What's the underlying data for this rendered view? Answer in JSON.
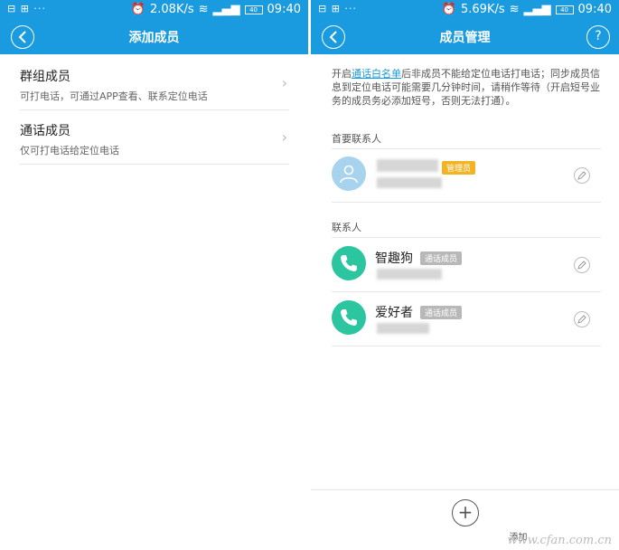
{
  "status_left": {
    "notif": "⊟ ⊞ ···",
    "speed": "2.08K/s",
    "time": "09:40",
    "battery": "40"
  },
  "status_right": {
    "notif": "⊟ ⊞ ···",
    "speed": "5.69K/s",
    "time": "09:40",
    "battery": "40"
  },
  "left_screen": {
    "title": "添加成员",
    "items": [
      {
        "title": "群组成员",
        "desc": "可打电话，可通过APP查看、联系定位电话"
      },
      {
        "title": "通话成员",
        "desc": "仅可打电话给定位电话"
      }
    ]
  },
  "right_screen": {
    "title": "成员管理",
    "notice_prefix": "开启",
    "notice_link": "通话白名单",
    "notice_suffix": "后非成员不能给定位电话打电话；同步成员信息到定位电话可能需要几分钟时间，请稍作等待（开启短号业务的成员务必添加短号，否则无法打通）。",
    "primary_label": "首要联系人",
    "primary_badge": "管理员",
    "contacts_label": "联系人",
    "contacts": [
      {
        "name": "智趣狗",
        "badge": "通话成员"
      },
      {
        "name": "爱好者",
        "badge": "通话成员"
      }
    ],
    "add_label": "添加",
    "watermark": "www.cfan.com.cn"
  },
  "colors": {
    "accent": "#1a9be0",
    "admin_badge": "#f2b424",
    "phone_avatar": "#2bc5a0"
  }
}
